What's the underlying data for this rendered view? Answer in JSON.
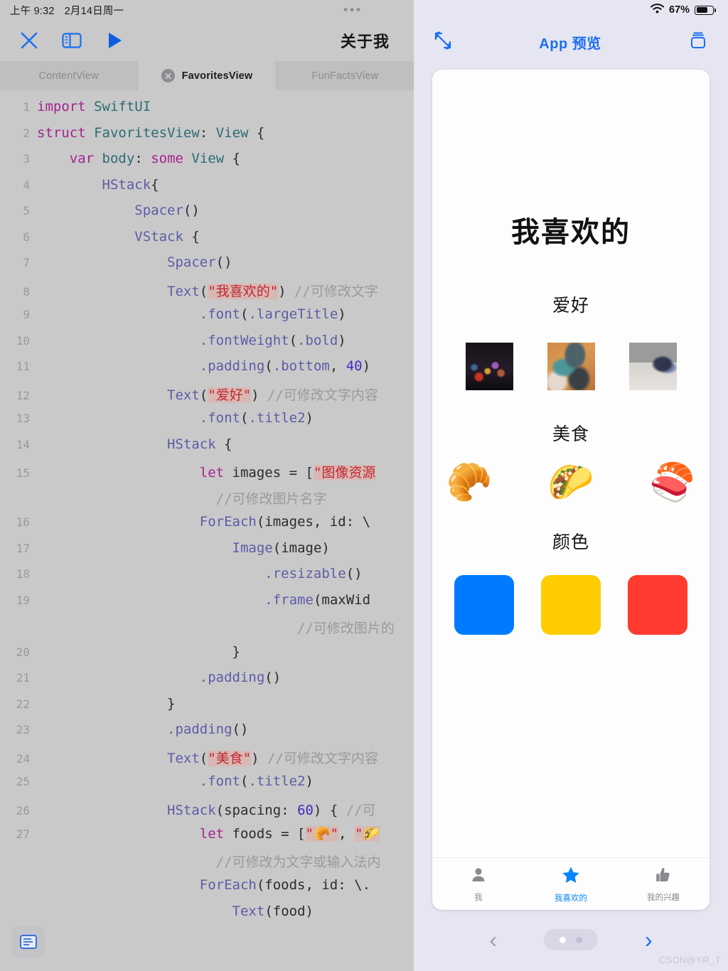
{
  "left": {
    "status": {
      "time": "上午 9:32",
      "date": "2月14日周一",
      "more": "•••"
    },
    "toolbar": {
      "close_label": "close-icon",
      "sidebar_label": "sidebar-icon",
      "run_label": "run-icon",
      "title": "关于我"
    },
    "tabs": [
      {
        "label": "ContentView",
        "active": false,
        "closable": false
      },
      {
        "label": "FavoritesView",
        "active": true,
        "closable": true
      },
      {
        "label": "FunFactsView",
        "active": false,
        "closable": false
      }
    ],
    "code": [
      {
        "num": "1",
        "tokens": [
          {
            "t": "import",
            "c": "kw"
          },
          {
            "t": " ",
            "c": "plain"
          },
          {
            "t": "SwiftUI",
            "c": "typ"
          }
        ]
      },
      {
        "num": "2",
        "tokens": [
          {
            "t": "struct",
            "c": "kw"
          },
          {
            "t": " ",
            "c": "plain"
          },
          {
            "t": "FavoritesView",
            "c": "typ"
          },
          {
            "t": ": ",
            "c": "plain"
          },
          {
            "t": "View",
            "c": "typ"
          },
          {
            "t": " {",
            "c": "plain"
          }
        ]
      },
      {
        "num": "3",
        "tokens": [
          {
            "t": "    ",
            "c": "plain"
          },
          {
            "t": "var",
            "c": "kw"
          },
          {
            "t": " ",
            "c": "plain"
          },
          {
            "t": "body",
            "c": "typ"
          },
          {
            "t": ": ",
            "c": "plain"
          },
          {
            "t": "some",
            "c": "kw"
          },
          {
            "t": " ",
            "c": "plain"
          },
          {
            "t": "View",
            "c": "typ"
          },
          {
            "t": " {",
            "c": "plain"
          }
        ]
      },
      {
        "num": "4",
        "tokens": [
          {
            "t": "        ",
            "c": "plain"
          },
          {
            "t": "HStack",
            "c": "fn"
          },
          {
            "t": "{",
            "c": "plain"
          }
        ]
      },
      {
        "num": "5",
        "tokens": [
          {
            "t": "            ",
            "c": "plain"
          },
          {
            "t": "Spacer",
            "c": "fn"
          },
          {
            "t": "()",
            "c": "plain"
          }
        ]
      },
      {
        "num": "6",
        "tokens": [
          {
            "t": "            ",
            "c": "plain"
          },
          {
            "t": "VStack",
            "c": "fn"
          },
          {
            "t": " {",
            "c": "plain"
          }
        ]
      },
      {
        "num": "7",
        "tokens": [
          {
            "t": "                ",
            "c": "plain"
          },
          {
            "t": "Spacer",
            "c": "fn"
          },
          {
            "t": "()",
            "c": "plain"
          }
        ]
      },
      {
        "num": "8",
        "tokens": [
          {
            "t": "                ",
            "c": "plain"
          },
          {
            "t": "Text",
            "c": "fn"
          },
          {
            "t": "(",
            "c": "plain"
          },
          {
            "t": "\"我喜欢的\"",
            "c": "str"
          },
          {
            "t": ") ",
            "c": "plain"
          },
          {
            "t": "//可修改文字",
            "c": "cmt"
          }
        ]
      },
      {
        "num": "9",
        "tokens": [
          {
            "t": "                    ",
            "c": "plain"
          },
          {
            "t": ".font",
            "c": "fn"
          },
          {
            "t": "(",
            "c": "plain"
          },
          {
            "t": ".largeTitle",
            "c": "fn"
          },
          {
            "t": ")",
            "c": "plain"
          }
        ]
      },
      {
        "num": "10",
        "tokens": [
          {
            "t": "                    ",
            "c": "plain"
          },
          {
            "t": ".fontWeight",
            "c": "fn"
          },
          {
            "t": "(",
            "c": "plain"
          },
          {
            "t": ".bold",
            "c": "fn"
          },
          {
            "t": ")",
            "c": "plain"
          }
        ]
      },
      {
        "num": "11",
        "tokens": [
          {
            "t": "                    ",
            "c": "plain"
          },
          {
            "t": ".padding",
            "c": "fn"
          },
          {
            "t": "(",
            "c": "plain"
          },
          {
            "t": ".bottom",
            "c": "fn"
          },
          {
            "t": ", ",
            "c": "plain"
          },
          {
            "t": "40",
            "c": "num"
          },
          {
            "t": ")",
            "c": "plain"
          }
        ]
      },
      {
        "num": "12",
        "tokens": [
          {
            "t": "                ",
            "c": "plain"
          },
          {
            "t": "Text",
            "c": "fn"
          },
          {
            "t": "(",
            "c": "plain"
          },
          {
            "t": "\"爱好\"",
            "c": "str"
          },
          {
            "t": ") ",
            "c": "plain"
          },
          {
            "t": "//可修改文字内容",
            "c": "cmt"
          }
        ]
      },
      {
        "num": "13",
        "tokens": [
          {
            "t": "                    ",
            "c": "plain"
          },
          {
            "t": ".font",
            "c": "fn"
          },
          {
            "t": "(",
            "c": "plain"
          },
          {
            "t": ".title2",
            "c": "fn"
          },
          {
            "t": ")",
            "c": "plain"
          }
        ]
      },
      {
        "num": "14",
        "tokens": [
          {
            "t": "                ",
            "c": "plain"
          },
          {
            "t": "HStack",
            "c": "fn"
          },
          {
            "t": " {",
            "c": "plain"
          }
        ]
      },
      {
        "num": "15",
        "tokens": [
          {
            "t": "                    ",
            "c": "plain"
          },
          {
            "t": "let",
            "c": "kw"
          },
          {
            "t": " images = [",
            "c": "plain"
          },
          {
            "t": "\"图像资源",
            "c": "str"
          }
        ]
      },
      {
        "num": "",
        "tokens": [
          {
            "t": "                      ",
            "c": "plain"
          },
          {
            "t": "//可修改图片名字",
            "c": "cmt"
          }
        ]
      },
      {
        "num": "16",
        "tokens": [
          {
            "t": "                    ",
            "c": "plain"
          },
          {
            "t": "ForEach",
            "c": "fn"
          },
          {
            "t": "(images, id: \\",
            "c": "plain"
          }
        ]
      },
      {
        "num": "17",
        "tokens": [
          {
            "t": "                        ",
            "c": "plain"
          },
          {
            "t": "Image",
            "c": "fn"
          },
          {
            "t": "(image)",
            "c": "plain"
          }
        ]
      },
      {
        "num": "18",
        "tokens": [
          {
            "t": "                            ",
            "c": "plain"
          },
          {
            "t": ".resizable",
            "c": "fn"
          },
          {
            "t": "()",
            "c": "plain"
          }
        ]
      },
      {
        "num": "19",
        "tokens": [
          {
            "t": "                            ",
            "c": "plain"
          },
          {
            "t": ".frame",
            "c": "fn"
          },
          {
            "t": "(maxWid",
            "c": "plain"
          }
        ]
      },
      {
        "num": "",
        "tokens": [
          {
            "t": "                                ",
            "c": "plain"
          },
          {
            "t": "//可修改图片的",
            "c": "cmt"
          }
        ]
      },
      {
        "num": "20",
        "tokens": [
          {
            "t": "                        ",
            "c": "plain"
          },
          {
            "t": "}",
            "c": "plain"
          }
        ]
      },
      {
        "num": "21",
        "tokens": [
          {
            "t": "                    ",
            "c": "plain"
          },
          {
            "t": ".padding",
            "c": "fn"
          },
          {
            "t": "()",
            "c": "plain"
          }
        ]
      },
      {
        "num": "22",
        "tokens": [
          {
            "t": "                ",
            "c": "plain"
          },
          {
            "t": "}",
            "c": "plain"
          }
        ]
      },
      {
        "num": "23",
        "tokens": [
          {
            "t": "                ",
            "c": "plain"
          },
          {
            "t": ".padding",
            "c": "fn"
          },
          {
            "t": "()",
            "c": "plain"
          }
        ]
      },
      {
        "num": "24",
        "tokens": [
          {
            "t": "                ",
            "c": "plain"
          },
          {
            "t": "Text",
            "c": "fn"
          },
          {
            "t": "(",
            "c": "plain"
          },
          {
            "t": "\"美食\"",
            "c": "str"
          },
          {
            "t": ") ",
            "c": "plain"
          },
          {
            "t": "//可修改文字内容",
            "c": "cmt"
          }
        ]
      },
      {
        "num": "25",
        "tokens": [
          {
            "t": "                    ",
            "c": "plain"
          },
          {
            "t": ".font",
            "c": "fn"
          },
          {
            "t": "(",
            "c": "plain"
          },
          {
            "t": ".title2",
            "c": "fn"
          },
          {
            "t": ")",
            "c": "plain"
          }
        ]
      },
      {
        "num": "26",
        "tokens": [
          {
            "t": "                ",
            "c": "plain"
          },
          {
            "t": "HStack",
            "c": "fn"
          },
          {
            "t": "(spacing: ",
            "c": "plain"
          },
          {
            "t": "60",
            "c": "num"
          },
          {
            "t": ") { ",
            "c": "plain"
          },
          {
            "t": "//可",
            "c": "cmt"
          }
        ]
      },
      {
        "num": "27",
        "tokens": [
          {
            "t": "                    ",
            "c": "plain"
          },
          {
            "t": "let",
            "c": "kw"
          },
          {
            "t": " foods = [",
            "c": "plain"
          },
          {
            "t": "\"🥐\"",
            "c": "str"
          },
          {
            "t": ", ",
            "c": "plain"
          },
          {
            "t": "\"🌮",
            "c": "str"
          }
        ]
      },
      {
        "num": "",
        "tokens": [
          {
            "t": "                      ",
            "c": "plain"
          },
          {
            "t": "//可修改为文字或输入法内",
            "c": "cmt"
          }
        ]
      },
      {
        "num": "",
        "tokens": [
          {
            "t": "                    ",
            "c": "plain"
          },
          {
            "t": "ForEach",
            "c": "fn"
          },
          {
            "t": "(foods, id: \\.",
            "c": "plain"
          }
        ]
      },
      {
        "num": "",
        "tokens": [
          {
            "t": "                        ",
            "c": "plain"
          },
          {
            "t": "Text",
            "c": "fn"
          },
          {
            "t": "(food)",
            "c": "plain"
          }
        ]
      }
    ],
    "console_button": "console-icon"
  },
  "right": {
    "status": {
      "wifi": "wifi-icon",
      "battery_percent": "67%"
    },
    "header": {
      "expand_label": "expand-icon",
      "title": "App 预览",
      "layers_label": "layers-icon"
    },
    "app": {
      "title": "我喜欢的",
      "sections": [
        {
          "label": "爱好",
          "kind": "images",
          "items": [
            "hobby-photo-1",
            "hobby-photo-2",
            "hobby-photo-3"
          ]
        },
        {
          "label": "美食",
          "kind": "emoji",
          "items": [
            "🥐",
            "🌮",
            "🍣"
          ]
        },
        {
          "label": "颜色",
          "kind": "colors",
          "items": [
            "#007AFF",
            "#FFCC00",
            "#FF3B30"
          ]
        }
      ],
      "tabs": [
        {
          "label": "我",
          "icon": "person-icon",
          "glyph": "👤",
          "active": false
        },
        {
          "label": "我喜欢的",
          "icon": "star-icon",
          "glyph": "★",
          "active": true
        },
        {
          "label": "我的兴趣",
          "icon": "thumbs-up-icon",
          "glyph": "👍",
          "active": false
        }
      ]
    },
    "footer": {
      "prev": "‹",
      "next": "›",
      "pages": 2,
      "current_page": 1
    }
  },
  "watermark": "CSDN@YR_T"
}
